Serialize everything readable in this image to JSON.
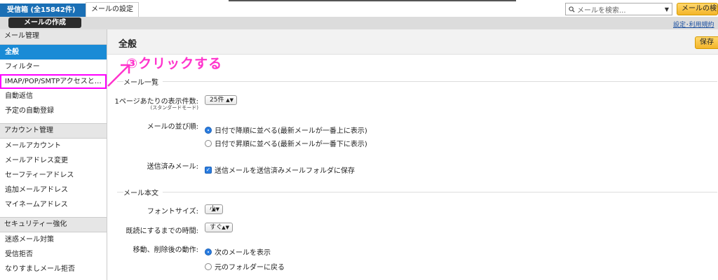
{
  "topbar": {
    "inbox_tab": "受信箱 (全15842件)",
    "settings_tab": "メールの設定",
    "search_placeholder": "メールを検索...",
    "search_button": "メールの検索"
  },
  "toolbar": {
    "compose_button": "メールの作成",
    "help_link": "設定･利用規約"
  },
  "sidebar": {
    "sections": [
      {
        "header": "メール管理",
        "items": [
          "全般",
          "フィルター",
          "IMAP/POP/SMTPアクセスと…",
          "自動返信",
          "予定の自動登録"
        ]
      },
      {
        "header": "アカウント管理",
        "items": [
          "メールアカウント",
          "メールアドレス変更",
          "セーフティーアドレス",
          "追加メールアドレス",
          "マイネームアドレス"
        ]
      },
      {
        "header": "セキュリティー強化",
        "items": [
          "迷惑メール対策",
          "受信拒否",
          "なりすましメール拒否"
        ]
      }
    ]
  },
  "main": {
    "title": "全般",
    "save_button": "保存",
    "annotation": "③クリックする",
    "mail_list": {
      "title": "メール一覧",
      "per_page_label": "1ページあたりの表示件数:",
      "per_page_sub": "(スタンダードモード)",
      "per_page_value": "25件",
      "sort_label": "メールの並び順:",
      "sort_options": [
        "日付で降順に並べる(最新メールが一番上に表示)",
        "日付で昇順に並べる(最新メールが一番下に表示)"
      ],
      "sent_label": "送信済みメール:",
      "sent_option": "送信メールを送信済みメールフォルダに保存"
    },
    "mail_body": {
      "title": "メール本文",
      "font_label": "フォントサイズ:",
      "font_value": "小",
      "read_label": "既読にするまでの時間:",
      "read_value": "すぐ",
      "move_label": "移動、削除後の動作:",
      "move_options": [
        "次のメールを表示",
        "元のフォルダーに戻る"
      ]
    }
  },
  "colors": {
    "accent": "#1a8bd6",
    "annotation": "#ff33cc",
    "button": "#f3b52a"
  }
}
